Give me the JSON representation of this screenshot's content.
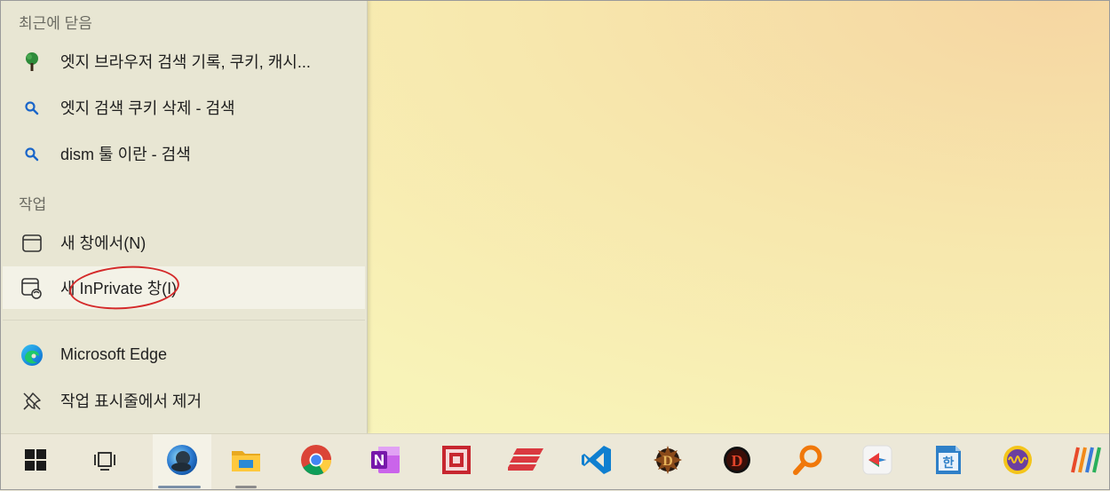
{
  "jumplist": {
    "recent_header": "최근에 닫음",
    "recent_items": [
      {
        "label": "엣지 브라우저 검색 기록, 쿠키, 캐시...",
        "icon": "tree-favicon-icon"
      },
      {
        "label": "엣지 검색 쿠키 삭제 - 검색",
        "icon": "search-icon"
      },
      {
        "label": "dism 툴 이란 - 검색",
        "icon": "search-icon"
      }
    ],
    "tasks_header": "작업",
    "task_items": [
      {
        "label": "새 창에서(N)",
        "icon": "new-window-icon"
      },
      {
        "label": "새 InPrivate 창(I)",
        "icon": "inprivate-window-icon"
      }
    ],
    "app_items": [
      {
        "label": "Microsoft Edge",
        "icon": "edge-icon"
      },
      {
        "label": "작업 표시줄에서 제거",
        "icon": "unpin-icon"
      }
    ]
  },
  "taskbar": {
    "icons": [
      "windows-start-icon",
      "task-view-icon",
      "edge-icon",
      "file-explorer-icon",
      "chrome-icon",
      "onenote-icon",
      "pixel-app-icon",
      "express-vpn-icon",
      "vscode-icon",
      "diablo-icon",
      "diablo-dark-icon",
      "magnifier-icon",
      "paint-app-icon",
      "hangul-icon",
      "audio-wave-icon",
      "stripes-app-icon"
    ]
  },
  "colors": {
    "accent_red": "#d42a2a",
    "panel_bg": "#e8e6d3",
    "taskbar_bg": "#ece8d8"
  }
}
